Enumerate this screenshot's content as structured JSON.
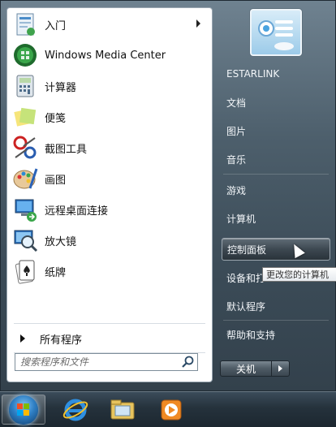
{
  "pinned_items": [
    {
      "label": "入门",
      "icon": "getting-started-icon",
      "has_submenu": true
    },
    {
      "label": "Windows Media Center",
      "icon": "media-center-icon"
    },
    {
      "label": "计算器",
      "icon": "calculator-icon"
    },
    {
      "label": "便笺",
      "icon": "sticky-notes-icon"
    },
    {
      "label": "截图工具",
      "icon": "snipping-tool-icon"
    },
    {
      "label": "画图",
      "icon": "paint-icon"
    },
    {
      "label": "远程桌面连接",
      "icon": "remote-desktop-icon"
    },
    {
      "label": "放大镜",
      "icon": "magnifier-icon"
    },
    {
      "label": "纸牌",
      "icon": "solitaire-icon"
    }
  ],
  "all_programs": "所有程序",
  "search": {
    "placeholder": "搜索程序和文件"
  },
  "right_items": {
    "user": "ESTARLINK",
    "documents": "文档",
    "pictures": "图片",
    "music": "音乐",
    "games": "游戏",
    "computer": "计算机",
    "control_panel": "控制面板",
    "devices": "设备和打",
    "default_programs": "默认程序",
    "help": "帮助和支持"
  },
  "tooltip": "更改您的计算机",
  "shutdown": "关机",
  "taskbar": [
    {
      "icon": "start-orb-icon",
      "active": true
    },
    {
      "icon": "internet-explorer-icon"
    },
    {
      "icon": "windows-explorer-icon"
    },
    {
      "icon": "media-player-icon"
    }
  ],
  "colors": {
    "menu_bg": "#4d5f6c",
    "highlight": "#3d4851",
    "taskbar": "#25323c"
  }
}
